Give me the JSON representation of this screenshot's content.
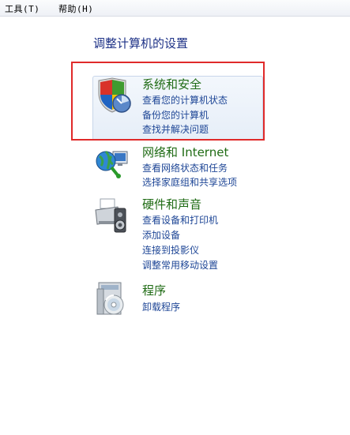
{
  "menubar": {
    "tools_label": "工具(T)",
    "help_label": "帮助(H)"
  },
  "page_title": "调整计算机的设置",
  "categories": [
    {
      "title": "系统和安全",
      "icon": "shield-security-icon",
      "links": [
        "查看您的计算机状态",
        "备份您的计算机",
        "查找并解决问题"
      ]
    },
    {
      "title": "网络和 Internet",
      "icon": "network-globe-icon",
      "links": [
        "查看网络状态和任务",
        "选择家庭组和共享选项"
      ]
    },
    {
      "title": "硬件和声音",
      "icon": "printer-speaker-icon",
      "links": [
        "查看设备和打印机",
        "添加设备",
        "连接到投影仪",
        "调整常用移动设置"
      ]
    },
    {
      "title": "程序",
      "icon": "programs-disc-icon",
      "links": [
        "卸载程序"
      ]
    }
  ],
  "colors": {
    "category_title": "#1f6b14",
    "link": "#1e4696",
    "highlight": "#e02a2a"
  }
}
